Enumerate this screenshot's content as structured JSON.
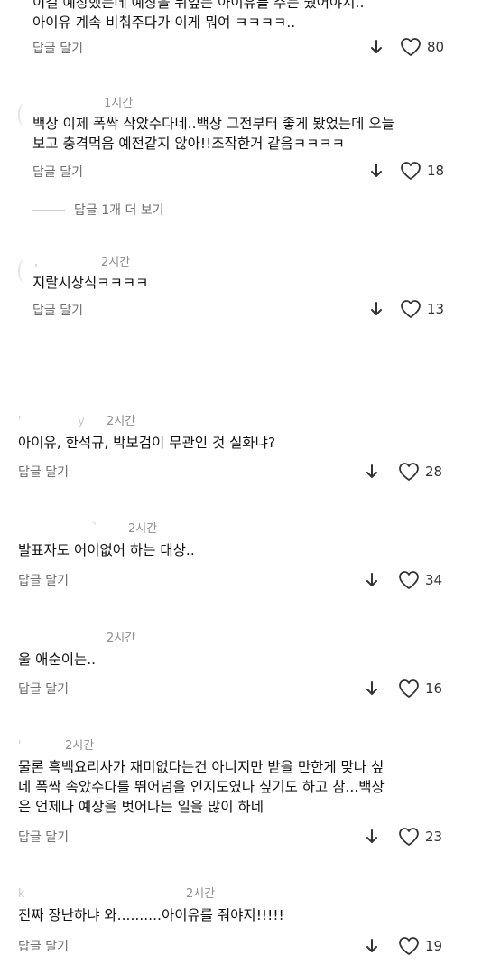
{
  "labels": {
    "reply": "답글 달기"
  },
  "comments": [
    {
      "id": "c0",
      "meta": "",
      "text": "이걸 예상했는데 예상을 뒤엎는 아이유를 주는 줬어야지..\n아이유 계속 비춰주다가 이게 뭐여 ㅋㅋㅋㅋ..",
      "likes": "80"
    },
    {
      "id": "c1",
      "meta": "1시간",
      "text": "백상 이제 폭싹 삭았수다네..백상 그전부터 좋게 봤었는데 오늘\n보고 충격먹음 예전같지 않아!!조작한거 같음ㅋㅋㅋㅋ",
      "likes": "18",
      "more_replies": "답글 1개 더 보기"
    },
    {
      "id": "c2",
      "meta": "2시간",
      "text": "지랄시상식ㅋㅋㅋㅋ",
      "likes": "13"
    },
    {
      "id": "c3",
      "meta": "2시간",
      "text": "아이유, 한석규, 박보검이 무관인 것 실화냐?",
      "likes": "28"
    },
    {
      "id": "c4",
      "meta": "2시간",
      "text": "발표자도 어이없어 하는 대상..",
      "likes": "34"
    },
    {
      "id": "c5",
      "meta": "2시간",
      "text": "울 애순이는..",
      "likes": "16"
    },
    {
      "id": "c6",
      "meta": "2시간",
      "text": "물론 흑백요리사가 재미없다는건 아니지만 받을 만한게 맞나 싶\n네 폭싹 속았수다를 뛰어넘을 인지도였나 싶기도 하고 참...백상\n은 언제나 예상을 벗어나는 일을 많이 하네",
      "likes": "23"
    },
    {
      "id": "c7",
      "meta": "2시간",
      "text": "진짜 장난하냐 와..........아이유를 줘야지!!!!!",
      "likes": "19"
    }
  ]
}
